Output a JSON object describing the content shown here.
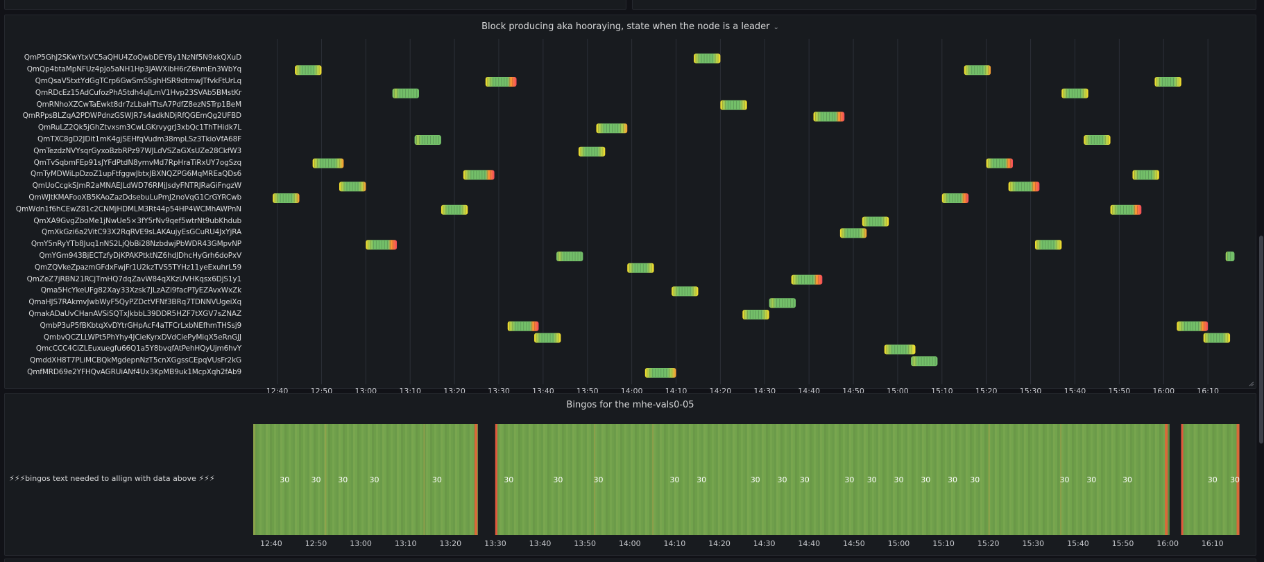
{
  "panel_top": {
    "title": ""
  },
  "panel_timeline": {
    "title": "Block producing aka hooraying, state when the node is a leader",
    "menu_icon": "chevron-down-icon"
  },
  "panel_bingos": {
    "title": "Bingos for the mhe-vals0-05",
    "row_label": "⚡⚡⚡bingos text needed to allign with data above ⚡⚡⚡"
  },
  "colors": {
    "green": "#73bf69",
    "yellow": "#fade2a",
    "orange": "#ff9830",
    "red": "#f2495c",
    "grid": "#2c3038",
    "panel_bg": "#181b1f"
  },
  "chart_data": [
    {
      "type": "state-timeline",
      "title": "Block producing aka hooraying, state when the node is a leader",
      "x_ticks": [
        "12:40",
        "12:50",
        "13:00",
        "13:10",
        "13:20",
        "13:30",
        "13:40",
        "13:50",
        "14:00",
        "14:10",
        "14:20",
        "14:30",
        "14:40",
        "14:50",
        "15:00",
        "15:10",
        "15:20",
        "15:30",
        "15:40",
        "15:50",
        "16:00",
        "16:10"
      ],
      "x_range_minutes": [
        756,
        980
      ],
      "rows": [
        {
          "name": "QmP5GhJ2SKwYtxVC5aQHU4ZoQwbDEYBy1NzNf5N9xkQXuD",
          "slots": [
            {
              "start": "14:14",
              "end": "14:20",
              "end_color": "yellow"
            }
          ]
        },
        {
          "name": "QmQp4btaMpNFUz4pJo5aNH1Hp3JAWXibH6rZ6hmEn3WbYq",
          "slots": [
            {
              "start": "12:44",
              "end": "12:50",
              "end_color": "yellow"
            },
            {
              "start": "15:15",
              "end": "15:21",
              "end_color": "orange"
            }
          ]
        },
        {
          "name": "QmQsaV5txtYdGgTCrp6GwSmS5ghHSR9dtmwJTfvkFtUrLq",
          "slots": [
            {
              "start": "13:27",
              "end": "13:34",
              "end_color": "red"
            },
            {
              "start": "15:58",
              "end": "16:04",
              "end_color": "yellow"
            }
          ]
        },
        {
          "name": "QmRDcEz15AdCufozPhA5tdh4uJLmV1Hvp23SVAb5BMstKr",
          "slots": [
            {
              "start": "13:06",
              "end": "13:12",
              "end_color": "green"
            },
            {
              "start": "15:37",
              "end": "15:43",
              "end_color": "yellow"
            }
          ]
        },
        {
          "name": "QmRNhoXZCwTaEwkt8dr7zLbaHTtsA7PdfZ8ezNSTrp1BeM",
          "slots": [
            {
              "start": "14:20",
              "end": "14:26",
              "end_color": "yellow"
            }
          ]
        },
        {
          "name": "QmRPpsBLZqA2PDWPdnzGSWJR7s4adkNDjRfQGEmQg2UFBD",
          "slots": [
            {
              "start": "14:41",
              "end": "14:48",
              "end_color": "red"
            }
          ]
        },
        {
          "name": "QmRuLZ2Qk5jGhZtvxsm3CwLGKrvygrJ3xbQc1ThTHidk7L",
          "slots": [
            {
              "start": "13:52",
              "end": "13:59",
              "end_color": "orange"
            }
          ]
        },
        {
          "name": "QmTXC8gD2JDit1mK4gjSEHfqVudm38mpLSz3TkioVfA68F",
          "slots": [
            {
              "start": "13:11",
              "end": "13:17",
              "end_color": "green"
            },
            {
              "start": "15:42",
              "end": "15:48",
              "end_color": "yellow"
            }
          ]
        },
        {
          "name": "QmTezdzNVYsqrGyxoBzbRPz97WJLdVSZaGXsUZe28CkfW3",
          "slots": [
            {
              "start": "13:48",
              "end": "13:54",
              "end_color": "yellow"
            }
          ]
        },
        {
          "name": "QmTvSqbmFEp91sJYFdPtdN8ymvMd7RpHraTiRxUY7ogSzq",
          "slots": [
            {
              "start": "12:48",
              "end": "12:55",
              "end_color": "orange"
            },
            {
              "start": "15:20",
              "end": "15:26",
              "end_color": "red"
            }
          ]
        },
        {
          "name": "QmTyMDWiLpDzoZ1upFtfggwJbtxJBXNQZPG6MqMREaQDs6",
          "slots": [
            {
              "start": "13:22",
              "end": "13:29",
              "end_color": "red"
            },
            {
              "start": "15:53",
              "end": "15:59",
              "end_color": "yellow"
            }
          ]
        },
        {
          "name": "QmUoCcgkSJmR2aMNAEJLdWD76RMjJsdyFNTRJRaGiFngzW",
          "slots": [
            {
              "start": "12:54",
              "end": "13:00",
              "end_color": "orange"
            },
            {
              "start": "15:25",
              "end": "15:32",
              "end_color": "red"
            }
          ]
        },
        {
          "name": "QmWJtKMAFooXB5KAoZazDdsebuLuPmJ2noVqG1CrGYRCwb",
          "slots": [
            {
              "start": "12:39",
              "end": "12:45",
              "end_color": "orange"
            },
            {
              "start": "15:10",
              "end": "15:16",
              "end_color": "red"
            }
          ]
        },
        {
          "name": "QmWdn1f6hCEwZ81c2CNMjHDMLM3Rt44p54HP4WCMhAWPnN",
          "slots": [
            {
              "start": "13:17",
              "end": "13:23",
              "end_color": "yellow"
            },
            {
              "start": "15:48",
              "end": "15:55",
              "end_color": "red"
            }
          ]
        },
        {
          "name": "QmXA9GvgZboMe1jNwUe5×3fY5rNv9qef5wtrNt9ubKhdub",
          "slots": [
            {
              "start": "14:52",
              "end": "14:58",
              "end_color": "yellow"
            }
          ]
        },
        {
          "name": "QmXkGzi6a2VitC93X2RqRVE9sLAKAujyEsGCuRU4JxYjRA",
          "slots": [
            {
              "start": "14:47",
              "end": "14:53",
              "end_color": "orange"
            }
          ]
        },
        {
          "name": "QmY5nRyYTb8Juq1nNS2LjQbBi28NzbdwjPbWDR43GMpvNP",
          "slots": [
            {
              "start": "13:00",
              "end": "13:07",
              "end_color": "red"
            },
            {
              "start": "15:31",
              "end": "15:37",
              "end_color": "yellow"
            }
          ]
        },
        {
          "name": "QmYGm943BjECTzfyDjKPAKPtktNZ6hdJDhcHyGrh6doPxV",
          "slots": [
            {
              "start": "13:43",
              "end": "13:49",
              "end_color": "green"
            },
            {
              "start": "16:14",
              "end": "16:16",
              "end_color": "green"
            }
          ]
        },
        {
          "name": "QmZQVkeZpazmGFdxFwjFr1U2kzTVS5TYHz11yeExuhrL59",
          "slots": [
            {
              "start": "13:59",
              "end": "14:05",
              "end_color": "yellow"
            }
          ]
        },
        {
          "name": "QmZeZ7jRBN21RCjTmHQ7dqZavW84qXKzUVHKqsx6DjS1y1",
          "slots": [
            {
              "start": "14:36",
              "end": "14:43",
              "end_color": "red"
            }
          ]
        },
        {
          "name": "Qma5HcYkeUFg82Xay33Xzsk7JLzAZi9facPTyEZAvxWxZk",
          "slots": [
            {
              "start": "14:09",
              "end": "14:15",
              "end_color": "yellow"
            }
          ]
        },
        {
          "name": "QmaHJS7RAkmvJwbWyF5QyPZDctVFNf3BRq7TDNNVUgeiXq",
          "slots": [
            {
              "start": "14:31",
              "end": "14:37",
              "end_color": "green"
            }
          ]
        },
        {
          "name": "QmakADaUvCHanAVSiSQTxJkbbL39DDR5HZF7tXGV7sZNAZ",
          "slots": [
            {
              "start": "14:25",
              "end": "14:31",
              "end_color": "yellow"
            }
          ]
        },
        {
          "name": "QmbP3uP5fBKbtqXvDYtrGHpAcF4aTFCrLxbNEfhmTHSsj9",
          "slots": [
            {
              "start": "13:32",
              "end": "13:39",
              "end_color": "red"
            },
            {
              "start": "16:03",
              "end": "16:10",
              "end_color": "red"
            }
          ]
        },
        {
          "name": "QmbvQCZLLWPt5PhYhy4JCieKyrxDVdCiePyMiqX5eRnGJJ",
          "slots": [
            {
              "start": "13:38",
              "end": "13:44",
              "end_color": "yellow"
            },
            {
              "start": "16:09",
              "end": "16:15",
              "end_color": "yellow"
            }
          ]
        },
        {
          "name": "QmcCCC4CiZLEuxuegfu66Q1a5Y8bvqfAtPehHQyUjm6hvY",
          "slots": [
            {
              "start": "14:57",
              "end": "15:04",
              "end_color": "yellow"
            }
          ]
        },
        {
          "name": "QmddXH8T7PLiMCBQkMgdepnNzT5cnXGgssCEpqVUsFr2kG",
          "slots": [
            {
              "start": "15:03",
              "end": "15:09",
              "end_color": "green"
            }
          ]
        },
        {
          "name": "QmfMRD69e2YFHQvAGRUiANf4Ux3KpMB9uk1McpXqh2fAb9",
          "slots": [
            {
              "start": "14:03",
              "end": "14:10",
              "end_color": "orange"
            }
          ]
        }
      ]
    },
    {
      "type": "state-timeline",
      "title": "Bingos for the mhe-vals0-05",
      "x_ticks": [
        "12:40",
        "12:50",
        "13:00",
        "13:10",
        "13:20",
        "13:30",
        "13:40",
        "13:50",
        "14:00",
        "14:10",
        "14:20",
        "14:30",
        "14:40",
        "14:50",
        "15:00",
        "15:10",
        "15:20",
        "15:30",
        "15:40",
        "15:50",
        "16:00",
        "16:10"
      ],
      "x_range_minutes": [
        756,
        977
      ],
      "segments": [
        {
          "start": "12:36",
          "end": "13:26"
        },
        {
          "start": "13:30",
          "end": "16:00"
        },
        {
          "start": "16:03",
          "end": "16:16"
        }
      ],
      "value_label": "30",
      "label_times": [
        "12:43",
        "12:50",
        "12:56",
        "13:03",
        "13:17",
        "13:33",
        "13:44",
        "13:53",
        "14:10",
        "14:16",
        "14:28",
        "14:34",
        "14:39",
        "14:49",
        "14:54",
        "15:00",
        "15:06",
        "15:12",
        "15:17",
        "15:37",
        "15:43",
        "15:51",
        "16:10",
        "16:15"
      ]
    }
  ]
}
